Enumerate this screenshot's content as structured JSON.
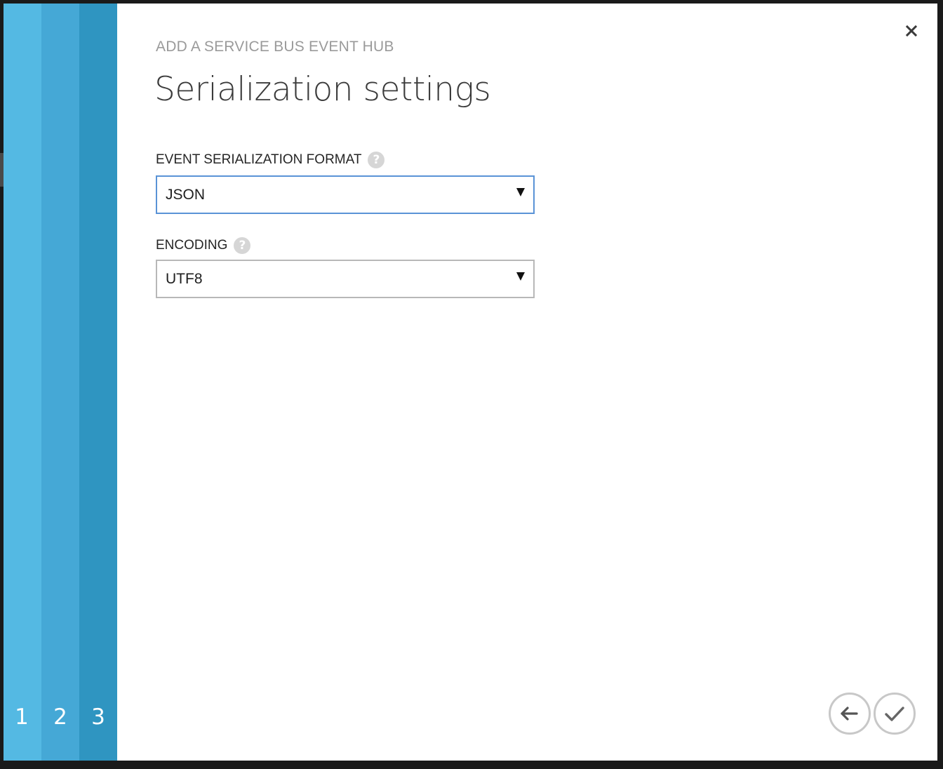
{
  "wizard": {
    "subtitle": "ADD A SERVICE BUS EVENT HUB",
    "title": "Serialization settings",
    "steps": [
      "1",
      "2",
      "3"
    ],
    "current_step": 3
  },
  "fields": {
    "serialization": {
      "label": "EVENT SERIALIZATION FORMAT",
      "value": "JSON",
      "help_icon": "question-mark-icon"
    },
    "encoding": {
      "label": "ENCODING",
      "value": "UTF8",
      "help_icon": "question-mark-icon"
    }
  },
  "actions": {
    "close_icon": "close-icon",
    "back_icon": "arrow-left-icon",
    "finish_icon": "checkmark-icon"
  },
  "colors": {
    "step1": "#54b9e3",
    "step2": "#45a8d6",
    "step3": "#2f95c1",
    "focus_border": "#5a93d6"
  }
}
